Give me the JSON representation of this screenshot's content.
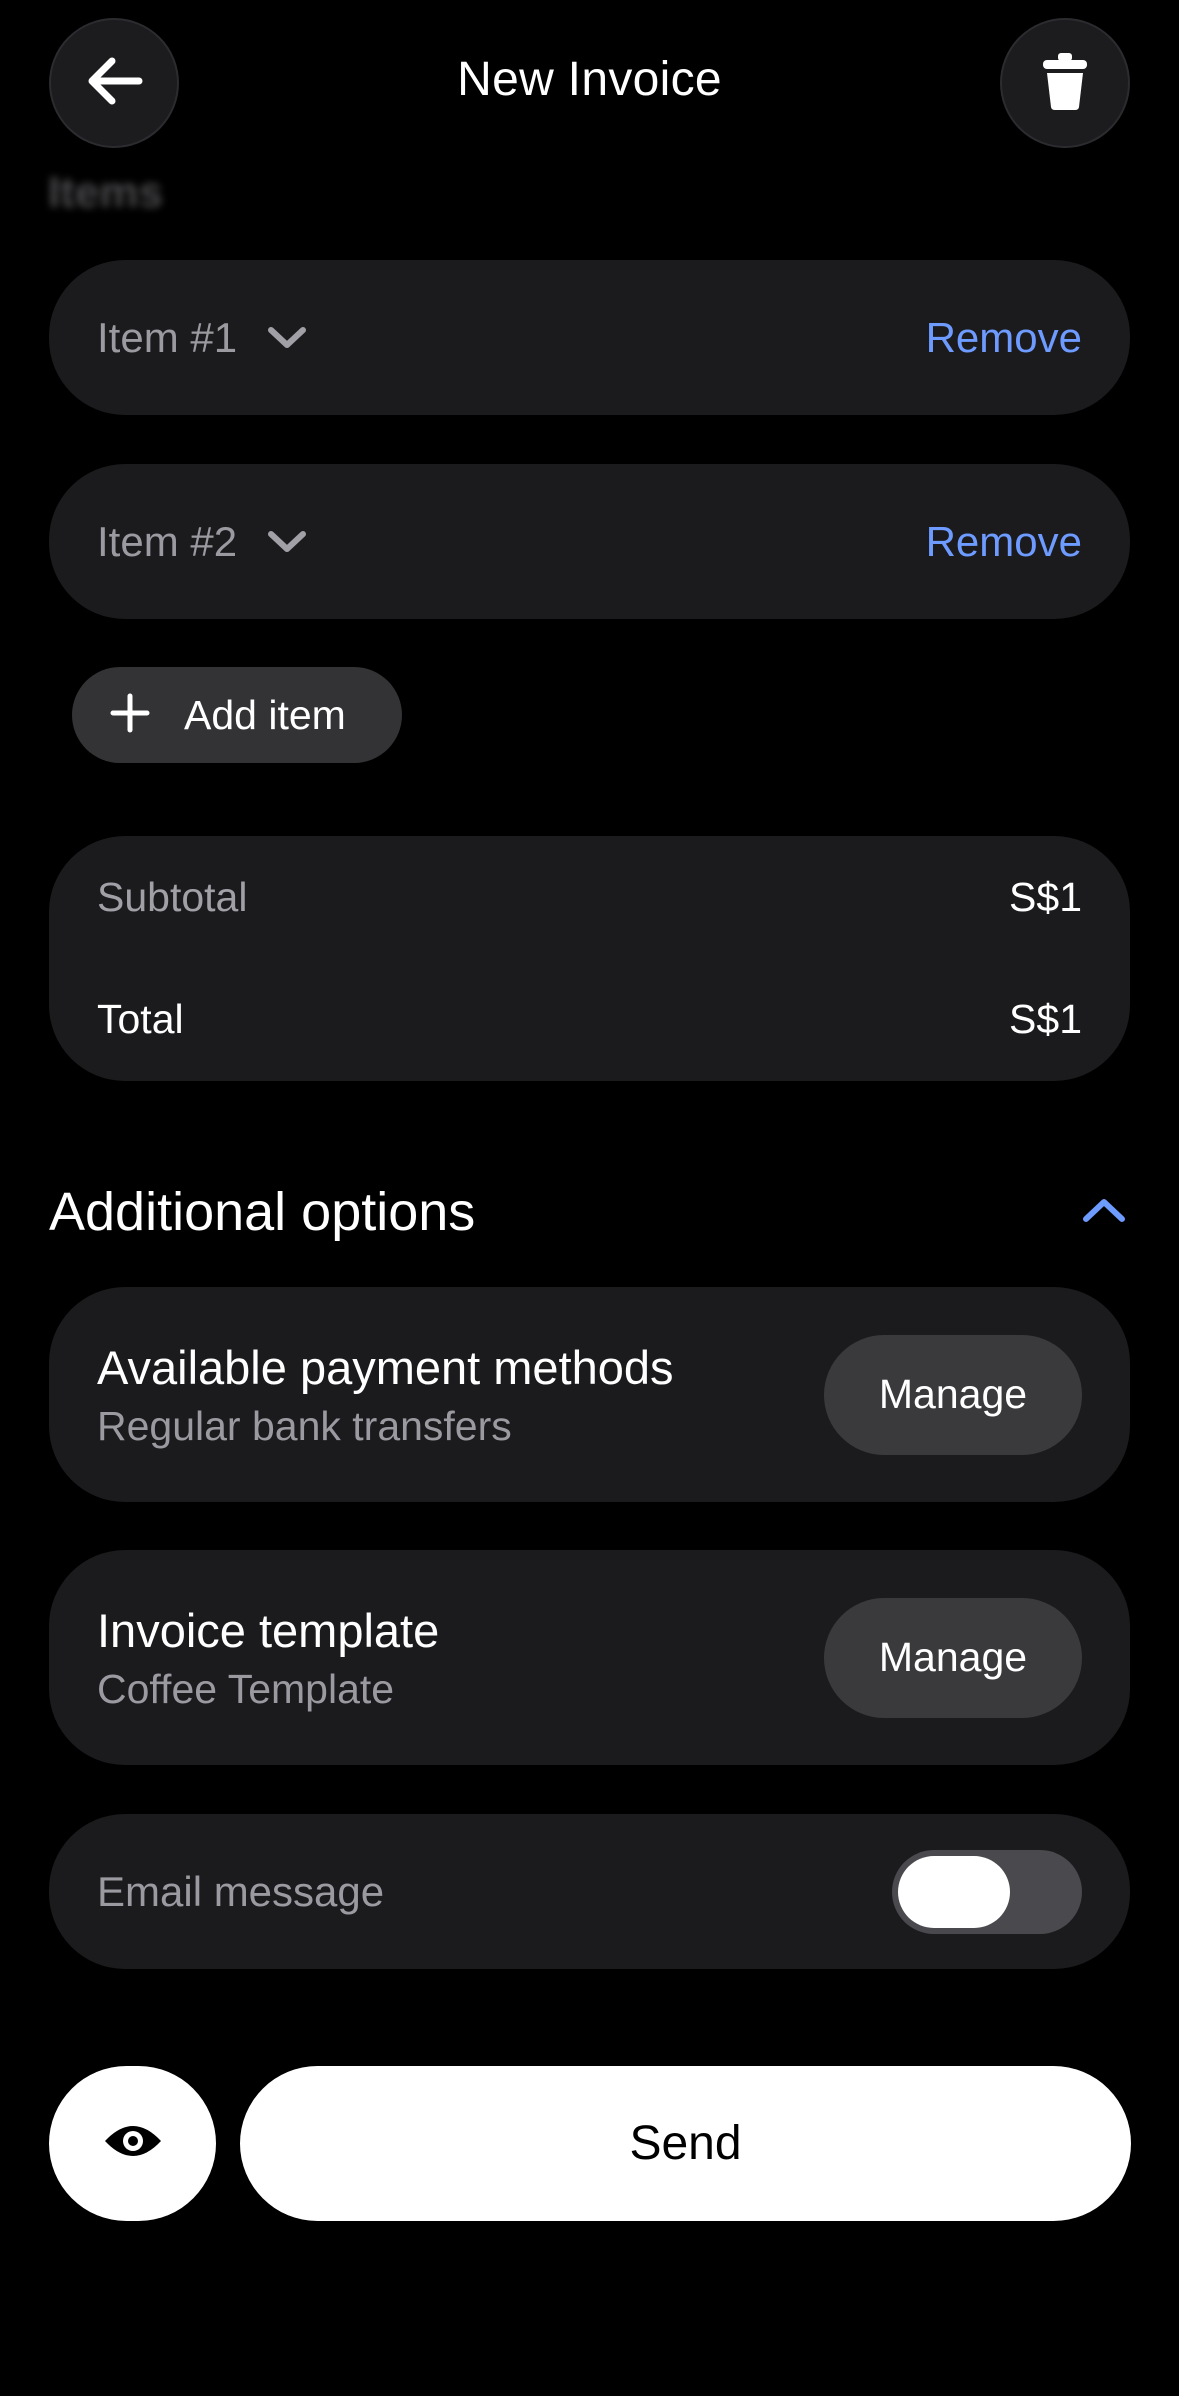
{
  "header": {
    "title": "New Invoice",
    "back_icon": "arrow-left-icon",
    "delete_icon": "trash-icon"
  },
  "items_section": {
    "heading": "Items",
    "items": [
      {
        "label": "Item #1",
        "action": "Remove"
      },
      {
        "label": "Item #2",
        "action": "Remove"
      }
    ],
    "add_label": "Add item"
  },
  "totals": {
    "subtotal_label": "Subtotal",
    "subtotal_value": "S$1",
    "total_label": "Total",
    "total_value": "S$1"
  },
  "additional_options": {
    "title": "Additional options",
    "payment": {
      "title": "Available payment methods",
      "subtitle": "Regular bank transfers",
      "button": "Manage"
    },
    "template": {
      "title": "Invoice template",
      "subtitle": "Coffee Template",
      "button": "Manage"
    },
    "email": {
      "label": "Email message",
      "enabled": false
    }
  },
  "footer": {
    "preview_icon": "eye-icon",
    "send_label": "Send"
  },
  "colors": {
    "background": "#000000",
    "card": "#1b1b1e",
    "accent": "#6e9bff",
    "muted_text": "#9a9aa0"
  }
}
